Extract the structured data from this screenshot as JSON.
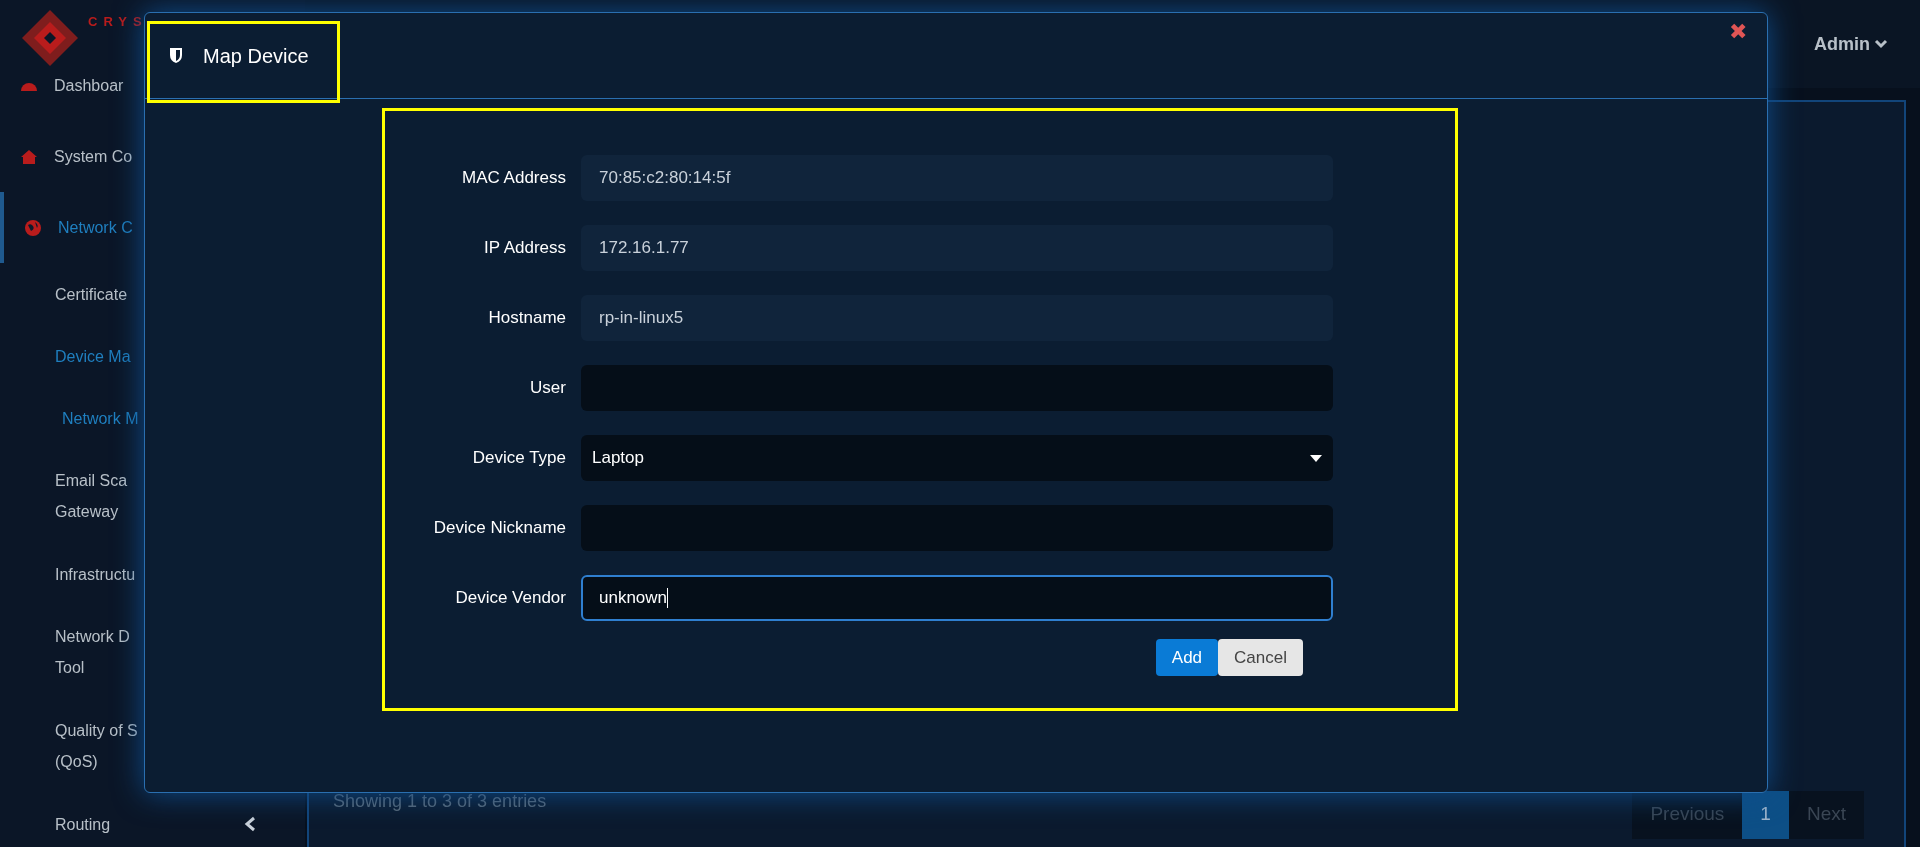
{
  "brand": {
    "text": "CRYS"
  },
  "sidebar": {
    "items": [
      {
        "label": "Dashboar",
        "selected": false,
        "kind": "section"
      },
      {
        "label": "System Co",
        "selected": false,
        "kind": "section"
      },
      {
        "label": "Network C",
        "selected": true,
        "kind": "section"
      },
      {
        "label": "Certificate ",
        "selected": false,
        "kind": "link"
      },
      {
        "label": "Device Ma",
        "selected": true,
        "kind": "link"
      },
      {
        "label": "Network M",
        "selected": true,
        "kind": "sublink"
      },
      {
        "label": "Email Sca\nGateway",
        "selected": false,
        "kind": "link"
      },
      {
        "label": "Infrastructu",
        "selected": false,
        "kind": "link"
      },
      {
        "label": "Network D\nTool",
        "selected": false,
        "kind": "link"
      },
      {
        "label": "Quality of S\n(QoS)",
        "selected": false,
        "kind": "link"
      },
      {
        "label": "Routing",
        "selected": false,
        "kind": "group"
      }
    ]
  },
  "topbar": {
    "user": "Admin"
  },
  "footer": {
    "info": "Showing 1 to 3 of 3 entries",
    "pages": [
      {
        "label": "Previous",
        "selected": false
      },
      {
        "label": "1",
        "selected": true
      },
      {
        "label": "Next",
        "selected": false
      }
    ]
  },
  "modal": {
    "title": "Map Device",
    "close": "✖",
    "fields": [
      {
        "kind": "text",
        "label": "MAC Address",
        "value": "70:85:c2:80:14:5f",
        "readonly": true,
        "focused": false
      },
      {
        "kind": "text",
        "label": "IP Address",
        "value": "172.16.1.77",
        "readonly": true,
        "focused": false
      },
      {
        "kind": "text",
        "label": "Hostname",
        "value": "rp-in-linux5",
        "readonly": true,
        "focused": false
      },
      {
        "kind": "text",
        "label": "User",
        "readonly": false,
        "focused": false
      },
      {
        "kind": "select",
        "label": "Device Type",
        "value": "Laptop",
        "readonly": false,
        "focused": false
      },
      {
        "kind": "text",
        "label": "Device Nickname",
        "readonly": false,
        "focused": false
      },
      {
        "kind": "text",
        "label": "Device Vendor",
        "value": "unknown",
        "readonly": false,
        "focused": true
      }
    ],
    "buttons": [
      {
        "label": "Add",
        "kind": "primary"
      },
      {
        "label": "Cancel",
        "kind": "default"
      }
    ]
  }
}
